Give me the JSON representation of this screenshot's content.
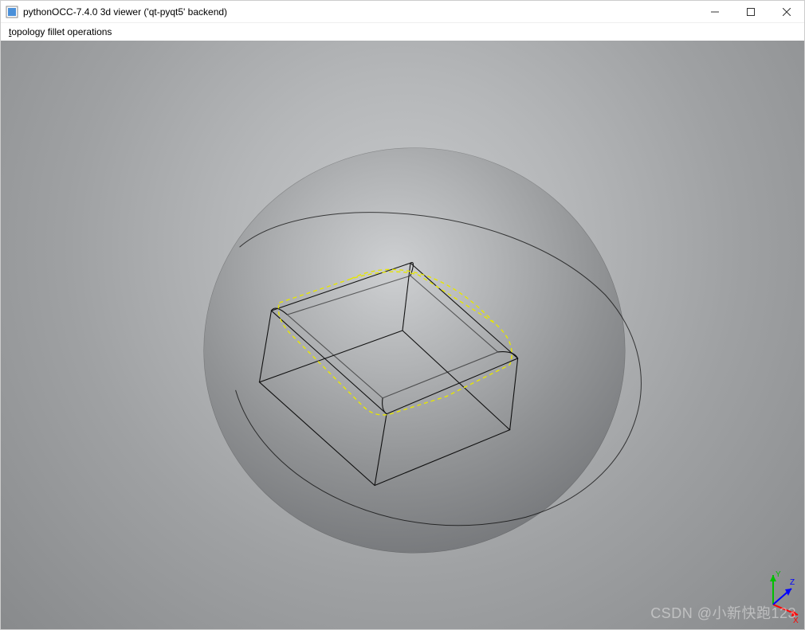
{
  "window": {
    "title": "pythonOCC-7.4.0 3d viewer ('qt-pyqt5' backend)"
  },
  "menubar": {
    "items": [
      {
        "label": "topology fillet operations",
        "mnemonic_index": 0
      }
    ]
  },
  "triad": {
    "x_label": "X",
    "y_label": "Y",
    "z_label": "Z",
    "x_color": "#ff0000",
    "y_color": "#00c000",
    "z_color": "#0000ff"
  },
  "watermark": "CSDN @小新快跑123",
  "scene": {
    "description": "Shaded sphere with intersecting filleted box wireframe; yellow dashed intersection curve on top face.",
    "highlight_color": "#e6e600",
    "wire_color": "#000000"
  }
}
